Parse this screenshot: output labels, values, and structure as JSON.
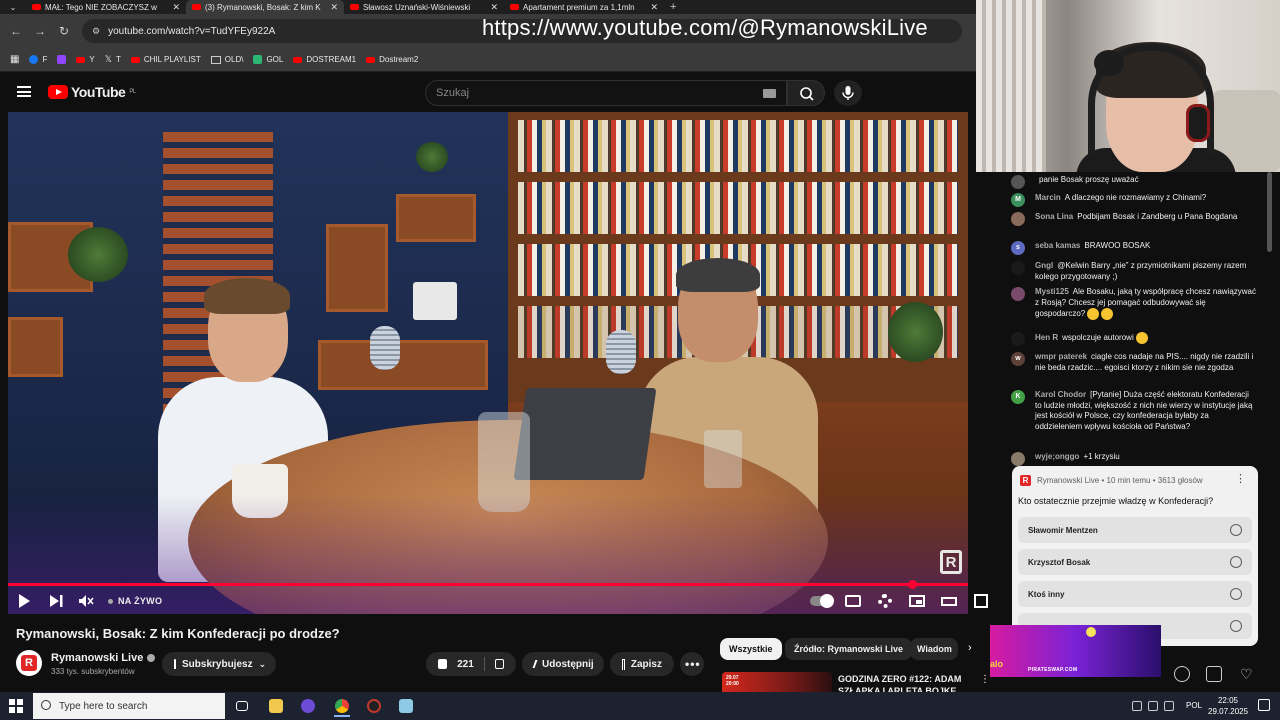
{
  "browser": {
    "tabs": [
      {
        "title": "MAŁ: Tego NIE ZOBACZYSZ w"
      },
      {
        "title": "(3) Rymanowski, Bosak: Z kim K"
      },
      {
        "title": "Sławosz Uznański-Wiśniewski"
      },
      {
        "title": "Apartament premium za 1,1mln"
      }
    ],
    "url": "youtube.com/watch?v=TudYFEy922A",
    "overlay_url": "https://www.youtube.com/@RymanowskiLive",
    "bookmarks": [
      {
        "label": "F",
        "color": "#1877f2"
      },
      {
        "label": "",
        "color": "#9146ff"
      },
      {
        "label": "Y",
        "color": "#ff0000"
      },
      {
        "label": "T",
        "color": "#000000"
      },
      {
        "label": "CHIL PLAYLIST",
        "color": "#ff0000"
      },
      {
        "label": "OLD\\",
        "color": "#888888"
      },
      {
        "label": "GOL",
        "color": "#2bb673"
      },
      {
        "label": "DOSTREAM1",
        "color": "#ff0000"
      },
      {
        "label": "Dostream2",
        "color": "#ff0000"
      }
    ]
  },
  "youtube": {
    "logo_text": "YouTube",
    "logo_region": "PL",
    "search_placeholder": "Szukaj"
  },
  "player": {
    "live_label": "NA ŻYWO",
    "watermark": "R"
  },
  "video": {
    "title": "Rymanowski, Bosak: Z kim Konfederacji po drodze?",
    "channel": "Rymanowski Live",
    "subscribers": "333 tys. subskrybentów",
    "subscribe_label": "Subskrybujesz",
    "likes": "221",
    "share_label": "Udostępnij",
    "save_label": "Zapisz"
  },
  "chips": [
    {
      "label": "Wszystkie",
      "active": true
    },
    {
      "label": "Źródło: Rymanowski Live",
      "active": false
    },
    {
      "label": "Wiadom",
      "active": false
    }
  ],
  "recommendation": {
    "title": "GODZINA ZERO #122: ADAM SZŁAPKA I ARLETA BOJKE",
    "thumb_label": "29.07 20:00"
  },
  "chat": {
    "messages": [
      {
        "author": "",
        "text": "panie Bosak proszę uważać",
        "avatar_color": "#555555",
        "initial": ""
      },
      {
        "author": "Marcin",
        "text": "A dlaczego nie rozmawiamy z Chinami?",
        "avatar_color": "#3a8f5a",
        "initial": "M"
      },
      {
        "author": "Sona Lina",
        "text": "Podbijam Bosak i Zandberg u Pana Bogdana",
        "avatar_color": "#8a6a5a",
        "initial": ""
      },
      {
        "author": "seba kamas",
        "text": "BRAWOO BOSAK",
        "avatar_color": "#5c6bc0",
        "initial": "s"
      },
      {
        "author": "Gngl",
        "text": "@Kelwin Barry „nie” z przymiotnikami piszemy razem kolego przygotowany ;)",
        "avatar_color": "#1a1a1a",
        "initial": ""
      },
      {
        "author": "Mysti125",
        "text": "Ale Bosaku, jaką ty współpracę chcesz nawiązywać z Rosją? Chcesz jej pomagać odbudowywać się gospodarczo?",
        "avatar_color": "#7a4a6a",
        "initial": ""
      },
      {
        "author": "Hen R",
        "text": "wspolczuje autorowi",
        "avatar_color": "#1a1a1a",
        "initial": ""
      },
      {
        "author": "wmpr paterek",
        "text": "ciagle cos nadaje na PIS.... nigdy nie rzadzili i nie beda rzadzic.... egoisci ktorzy z nikim sie nie zgodza",
        "avatar_color": "#5d4037",
        "initial": "w"
      },
      {
        "author": "Karol Chodor",
        "text": "[Pytanie] Duża część elektoratu Konfederacji to ludzie młodzi, większość z nich nie wierzy w instytucje jaką jest kościół w Polsce, czy konfederacja byłaby za oddzieleniem wpływu kościoła od Państwa?",
        "avatar_color": "#43a047",
        "initial": "K"
      },
      {
        "author": "wyje;onggo",
        "text": "+1 krzysiu",
        "avatar_color": "#8a7a6a",
        "initial": ""
      }
    ]
  },
  "poll": {
    "meta": "Rymanowski Live • 10 min temu • 3613 głosów",
    "question": "Kto ostatecznie przejmie władzę w Konfederacji?",
    "options": [
      {
        "label": "Sławomir Mentzen"
      },
      {
        "label": "Krzysztof Bosak"
      },
      {
        "label": "Ktoś inny"
      },
      {
        "label": ""
      }
    ]
  },
  "ad": {
    "text": "PIRATESWAP.COM",
    "left_text": "alo"
  },
  "taskbar": {
    "search_placeholder": "Type here to search",
    "language": "POL",
    "time": "22:05",
    "date": "29.07.2025"
  }
}
